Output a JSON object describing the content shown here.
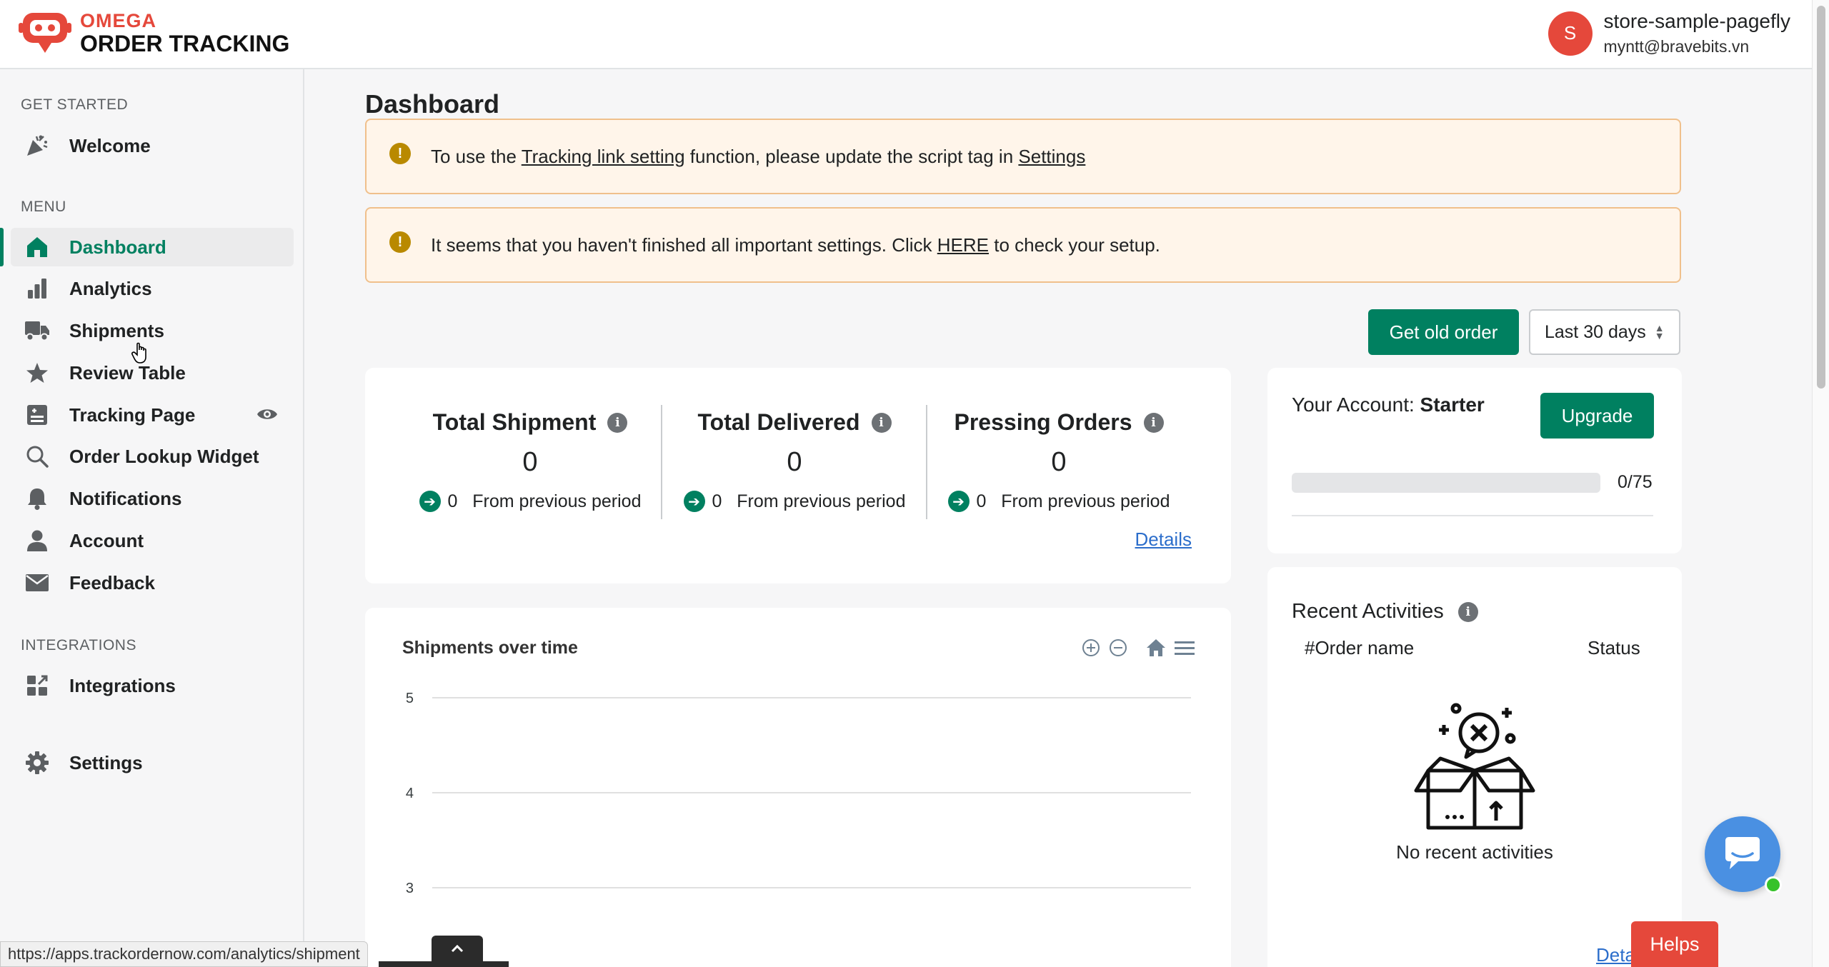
{
  "app": {
    "logo_line1": "OMEGA",
    "logo_line2": "ORDER TRACKING",
    "brand_color": "#e5483b",
    "accent_color": "#008060"
  },
  "user": {
    "initial": "S",
    "store": "store-sample-pagefly",
    "email": "myntt@bravebits.vn"
  },
  "sidebar": {
    "get_started_label": "GET STARTED",
    "menu_label": "MENU",
    "integrations_label": "INTEGRATIONS",
    "items": [
      {
        "label": "Welcome",
        "icon": "party-icon"
      },
      {
        "label": "Dashboard",
        "icon": "home-icon",
        "active": true
      },
      {
        "label": "Analytics",
        "icon": "bar-chart-icon"
      },
      {
        "label": "Shipments",
        "icon": "truck-icon"
      },
      {
        "label": "Review Table",
        "icon": "star-icon"
      },
      {
        "label": "Tracking Page",
        "icon": "page-plus-icon"
      },
      {
        "label": "Order Lookup Widget",
        "icon": "search-icon"
      },
      {
        "label": "Notifications",
        "icon": "bell-icon"
      },
      {
        "label": "Account",
        "icon": "person-icon"
      },
      {
        "label": "Feedback",
        "icon": "envelope-icon"
      },
      {
        "label": "Integrations",
        "icon": "integrations-icon"
      },
      {
        "label": "Settings",
        "icon": "gear-icon"
      }
    ]
  },
  "main": {
    "title": "Dashboard",
    "banner1": {
      "prefix": "To use the ",
      "link1": "Tracking link setting",
      "middle": " function, please update the script tag in ",
      "link2": "Settings"
    },
    "banner2": {
      "prefix": "It seems that you haven't finished all important settings. Click ",
      "link": "HERE",
      "suffix": " to check your setup."
    },
    "get_old_order": "Get old order",
    "period": "Last 30 days"
  },
  "stats": [
    {
      "title": "Total Shipment",
      "value": "0",
      "delta": "0",
      "delta_label": "From previous period"
    },
    {
      "title": "Total Delivered",
      "value": "0",
      "delta": "0",
      "delta_label": "From previous period"
    },
    {
      "title": "Pressing Orders",
      "value": "0",
      "delta": "0",
      "delta_label": "From previous period"
    }
  ],
  "stats_details": "Details",
  "account": {
    "label": "Your Account: ",
    "plan": "Starter",
    "upgrade": "Upgrade",
    "usage_text": "0/75",
    "usage_fraction": 0
  },
  "recent": {
    "title": "Recent Activities",
    "col_order": "#Order name",
    "col_status": "Status",
    "empty": "No recent activities",
    "details": "Details"
  },
  "chart_data": {
    "type": "line",
    "title": "Shipments over time",
    "y_ticks": [
      5,
      4,
      3
    ],
    "ylim": [
      3,
      5
    ],
    "grid": true,
    "series": []
  },
  "helps": "Helps",
  "status_url": "https://apps.trackordernow.com/analytics/shipment"
}
